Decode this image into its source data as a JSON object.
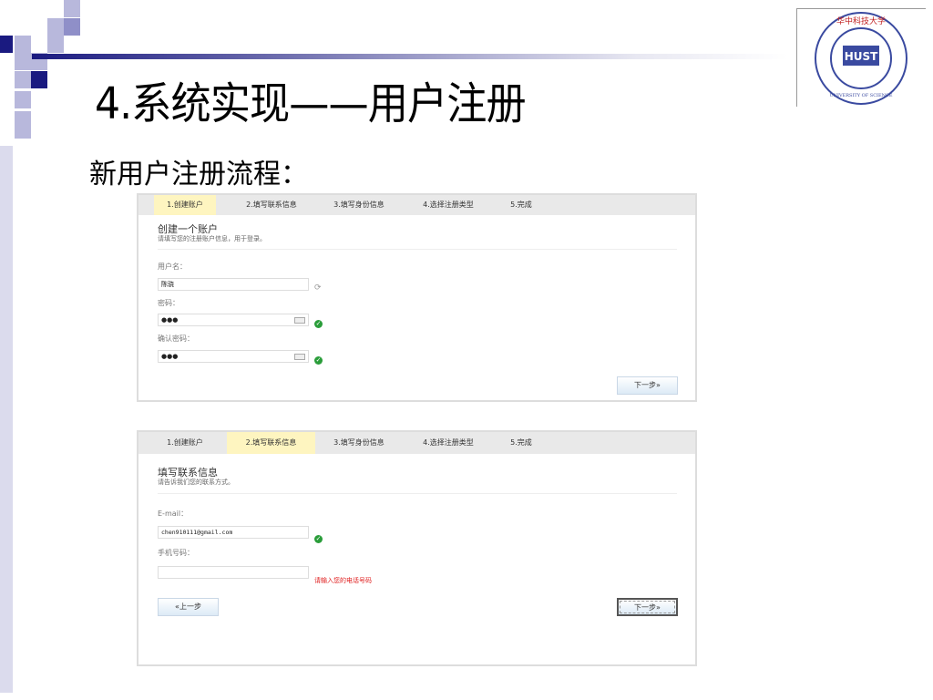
{
  "slide": {
    "title": "4.系统实现——用户注册",
    "subtitle": "新用户注册流程："
  },
  "logo": {
    "top_text": "华中科技大学",
    "ring_text": "HUAZHONG UNIVERSITY OF SCIENCE AND TECHNOLOGY",
    "center_text": "HUST"
  },
  "steps": [
    "1.创建账户",
    "2.填写联系信息",
    "3.填写身份信息",
    "4.选择注册类型",
    "5.完成"
  ],
  "shot1": {
    "heading": "创建一个账户",
    "hint": "请填写您的注册账户信息，用于登录。",
    "username_label": "用户名：",
    "username_value": "陈骁",
    "password_label": "密码：",
    "password_value": "●●●",
    "confirm_label": "确认密码：",
    "confirm_value": "●●●",
    "next": "下一步»"
  },
  "shot2": {
    "heading": "填写联系信息",
    "hint": "请告诉我们您的联系方式。",
    "email_label": "E-mail：",
    "email_value": "chen910111@gmail.com",
    "phone_label": "手机号码：",
    "phone_value": "",
    "phone_error": "请输入您的电话号码",
    "prev": "«上一步",
    "next": "下一步»"
  },
  "colors": {
    "accent": "#1a1a80",
    "active_tab": "#fef5c0",
    "ok": "#2a9d3a",
    "error": "#e02020"
  }
}
